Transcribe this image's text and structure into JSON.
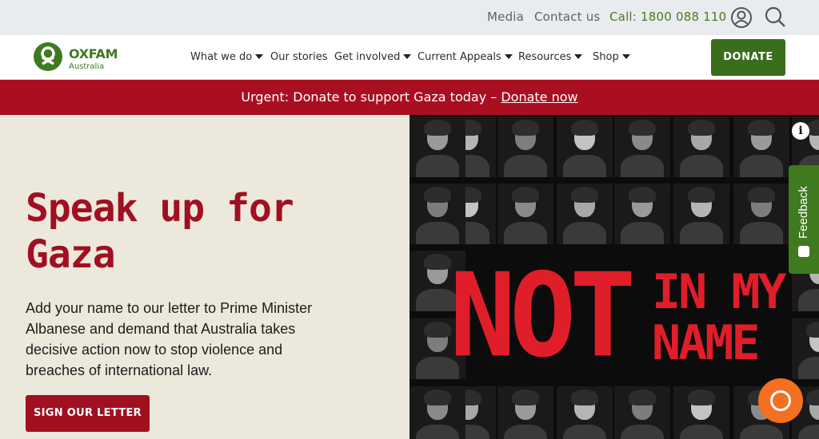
{
  "utility_bar": {
    "media": "Media",
    "contact": "Contact us",
    "call": "Call: 1800 088 110",
    "account_icon": "user-circle-icon",
    "search_icon": "search-icon"
  },
  "logo": {
    "name": "OXFAM",
    "sub": "Australia"
  },
  "nav": {
    "items": [
      {
        "label": "What we do",
        "has_dropdown": true
      },
      {
        "label": "Our stories",
        "has_dropdown": false
      },
      {
        "label": "Get involved",
        "has_dropdown": true
      },
      {
        "label": "Current Appeals",
        "has_dropdown": true
      },
      {
        "label": "Resources",
        "has_dropdown": true
      },
      {
        "label": "Shop",
        "has_dropdown": true
      }
    ],
    "donate": "DONATE"
  },
  "urgent_banner": {
    "text": "Urgent: Donate to support Gaza today –",
    "link": "Donate now"
  },
  "hero": {
    "title": "Speak up for Gaza",
    "body": "Add your name to our letter to Prime Minister Albanese and demand that Australia takes decisive action now to stop violence and breaches of international law.",
    "cta": "SIGN OUR LETTER",
    "image_text_big": "NOT",
    "image_text_line1": "IN MY",
    "image_text_line2": "NAME"
  },
  "widgets": {
    "info_icon": "info-icon",
    "feedback": "Feedback",
    "chat_icon": "chat-bubble-icon"
  },
  "colors": {
    "brand_green": "#3f7a1f",
    "urgent_red": "#a90f20",
    "hero_bg": "#ece8dc",
    "chat_orange": "#f36f21"
  }
}
